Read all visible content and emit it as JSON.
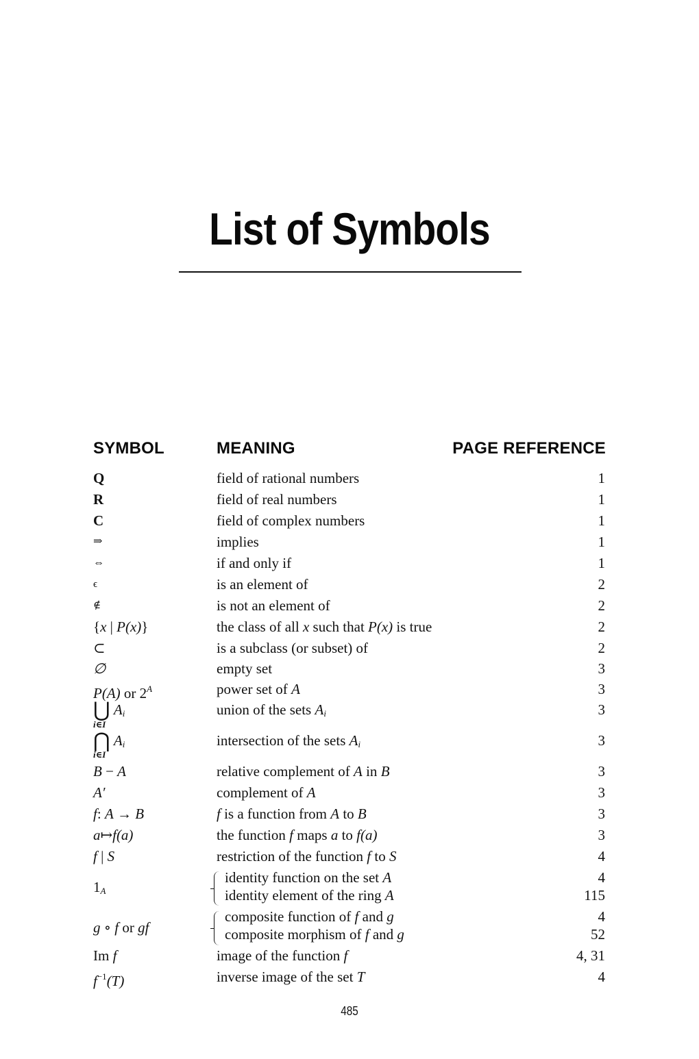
{
  "title": "List of Symbols",
  "headers": {
    "symbol": "SYMBOL",
    "meaning": "MEANING",
    "page": "PAGE REFERENCE"
  },
  "rows": [
    {
      "symbol": "Q",
      "meaning": "field of rational numbers",
      "page": "1"
    },
    {
      "symbol": "R",
      "meaning": "field of real numbers",
      "page": "1"
    },
    {
      "symbol": "C",
      "meaning": "field of complex numbers",
      "page": "1"
    },
    {
      "symbol": "⇒",
      "meaning": "implies",
      "page": "1"
    },
    {
      "symbol": "⇔",
      "meaning": "if and only if",
      "page": "1"
    },
    {
      "symbol": "ϵ",
      "meaning": "is an element of",
      "page": "2"
    },
    {
      "symbol": "∉",
      "meaning": "is not an element of",
      "page": "2"
    },
    {
      "symbol": "{x | P(x)}",
      "meaning": "the class of all x such that P(x) is true",
      "page": "2"
    },
    {
      "symbol": "⊂",
      "meaning": "is a subclass (or subset) of",
      "page": "2"
    },
    {
      "symbol": "∅",
      "meaning": "empty set",
      "page": "3"
    },
    {
      "symbol": "P(A) or 2^A",
      "meaning": "power set of A",
      "page": "3"
    },
    {
      "symbol": "⋃ A_i (i∈I)",
      "meaning": "union of the sets A_i",
      "page": "3"
    },
    {
      "symbol": "⋂ A_i (i∈I)",
      "meaning": "intersection of the sets A_i",
      "page": "3"
    },
    {
      "symbol": "B − A",
      "meaning": "relative complement of A in B",
      "page": "3"
    },
    {
      "symbol": "A′",
      "meaning": "complement of A",
      "page": "3"
    },
    {
      "symbol": "f: A → B",
      "meaning": "f is a function from A to B",
      "page": "3"
    },
    {
      "symbol": "a ↦ f(a)",
      "meaning": "the function f maps a to f(a)",
      "page": "3"
    },
    {
      "symbol": "f | S",
      "meaning": "restriction of the function f to S",
      "page": "4"
    },
    {
      "symbol": "1_A",
      "meanings": [
        {
          "meaning": "identity function on the set A",
          "page": "4"
        },
        {
          "meaning": "identity element of the ring A",
          "page": "115"
        }
      ]
    },
    {
      "symbol": "g ∘ f or gf",
      "meanings": [
        {
          "meaning": "composite function of f and g",
          "page": "4"
        },
        {
          "meaning": "composite morphism of f and g",
          "page": "52"
        }
      ]
    },
    {
      "symbol": "Im f",
      "meaning": "image of the function f",
      "page": "4, 31"
    },
    {
      "symbol": "f⁻¹(T)",
      "meaning": "inverse image of the set T",
      "page": "4"
    }
  ],
  "parts": {
    "Q": "Q",
    "R": "R",
    "C": "C",
    "implies": "⇒",
    "iff": "⇔",
    "in": "ϵ",
    "notin": "∉",
    "lbrace": "{",
    "x": "x",
    "bar": " | ",
    "Px": "P(x)",
    "rbrace": "}",
    "subset": "⊂",
    "empty": "∅",
    "PA": "P(A)",
    "or": " or ",
    "two": "2",
    "A": "A",
    "union": "⋃",
    "inter": "⋂",
    "Ai": "A",
    "i": "i",
    "iI": "i∈I",
    "B": "B",
    "minus": " − ",
    "prime": "′",
    "f": "f",
    "colon": ": ",
    "arrow": " → ",
    "a": "a",
    "mapsto": "↦",
    "fa": "f(a)",
    "S": "S",
    "one": "1",
    "g": "g",
    "circ": " ∘ ",
    "gf": "gf",
    "Im": "Im ",
    "finv": "f",
    "inv": "−1",
    "T": "(T)",
    "m_class_1": "the class of all ",
    "m_class_2": " such that ",
    "m_class_3": " is true",
    "m_power": "power set of ",
    "m_union": "union of the sets ",
    "m_inter": "intersection of the sets ",
    "m_rel_1": "relative complement of ",
    "m_rel_2": " in ",
    "m_comp": "complement of ",
    "m_func_1": " is a function from ",
    "m_to": " to ",
    "m_maps_1": "the function ",
    "m_maps_2": " maps ",
    "m_restr_1": "restriction of the function ",
    "m_id1": "identity function on the set ",
    "m_id2": "identity element of the ring ",
    "m_cf": "composite function of ",
    "m_cm": "composite morphism of ",
    "m_and": " and ",
    "m_im": "image of the function ",
    "m_inv": "inverse image of the set ",
    "m_T": "T"
  },
  "footer": {
    "page_number": "485"
  }
}
